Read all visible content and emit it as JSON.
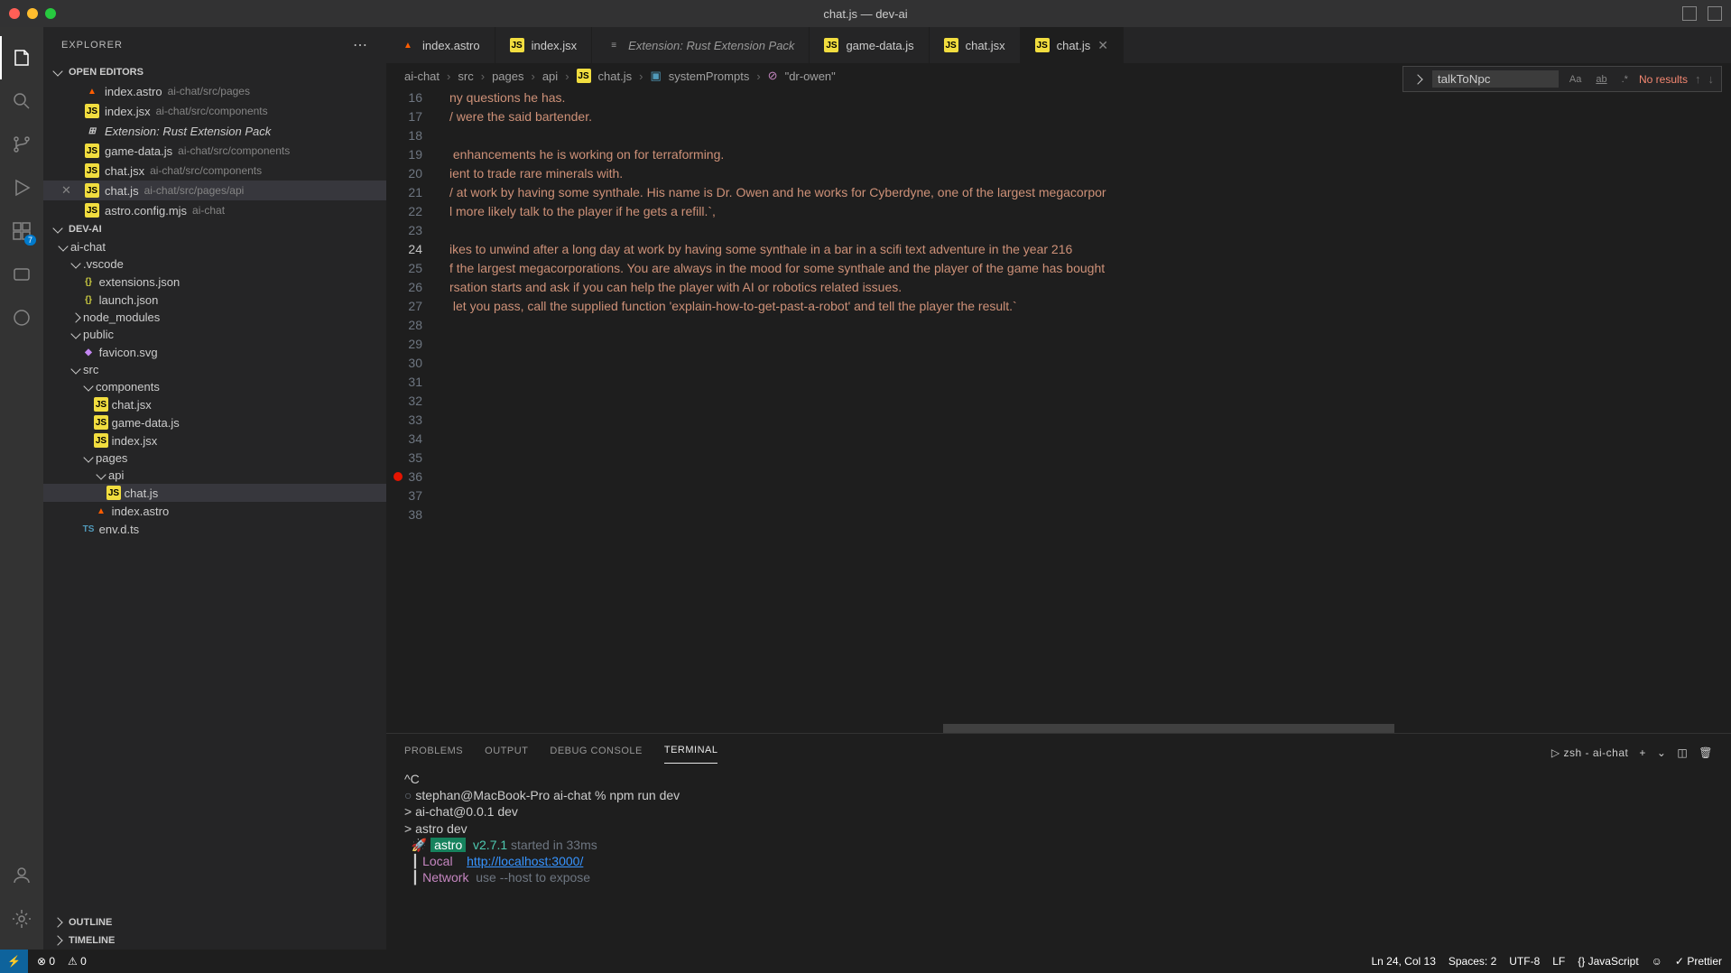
{
  "window": {
    "title": "chat.js — dev-ai"
  },
  "activity": {
    "badge": "7"
  },
  "explorer": {
    "title": "EXPLORER",
    "openEditors": "OPEN EDITORS",
    "editors": [
      {
        "name": "index.astro",
        "path": "ai-chat/src/pages",
        "icon": "astro"
      },
      {
        "name": "index.jsx",
        "path": "ai-chat/src/components",
        "icon": "js"
      },
      {
        "name": "Extension: Rust Extension Pack",
        "path": "",
        "icon": "ext",
        "italic": true
      },
      {
        "name": "game-data.js",
        "path": "ai-chat/src/components",
        "icon": "js"
      },
      {
        "name": "chat.jsx",
        "path": "ai-chat/src/components",
        "icon": "js"
      },
      {
        "name": "chat.js",
        "path": "ai-chat/src/pages/api",
        "icon": "js",
        "active": true,
        "close": true
      },
      {
        "name": "astro.config.mjs",
        "path": "ai-chat",
        "icon": "js"
      }
    ],
    "project": "DEV-AI",
    "tree": {
      "aichat": "ai-chat",
      "vscode": ".vscode",
      "extensions": "extensions.json",
      "launch": "launch.json",
      "nodemodules": "node_modules",
      "public": "public",
      "favicon": "favicon.svg",
      "src": "src",
      "components": "components",
      "chatjsx": "chat.jsx",
      "gamedata": "game-data.js",
      "indexjsx": "index.jsx",
      "pages": "pages",
      "api": "api",
      "chatjs": "chat.js",
      "indexastro": "index.astro",
      "envdts": "env.d.ts"
    },
    "outline": "OUTLINE",
    "timeline": "TIMELINE"
  },
  "tabs": [
    {
      "label": "index.astro",
      "icon": "astro"
    },
    {
      "label": "index.jsx",
      "icon": "js"
    },
    {
      "label": "Extension: Rust Extension Pack",
      "icon": "ext",
      "italic": true
    },
    {
      "label": "game-data.js",
      "icon": "js"
    },
    {
      "label": "chat.jsx",
      "icon": "js"
    },
    {
      "label": "chat.js",
      "icon": "js",
      "active": true,
      "close": true
    }
  ],
  "breadcrumb": {
    "p1": "ai-chat",
    "p2": "src",
    "p3": "pages",
    "p4": "api",
    "p5": "chat.js",
    "p6": "systemPrompts",
    "p7": "\"dr-owen\""
  },
  "find": {
    "value": "talkToNpc",
    "results": "No results"
  },
  "code": {
    "startLine": 16,
    "breakpointLine": 36,
    "currentLine": 24,
    "lines": [
      "ny questions he has.",
      "/ were the said bartender.",
      "",
      " enhancements he is working on for terraforming.",
      "ient to trade rare minerals with.",
      "/ at work by having some synthale. His name is Dr. Owen and he works for Cyberdyne, one of the largest megacorpor",
      "l more likely talk to the player if he gets a refill.`,",
      "",
      "ikes to unwind after a long day at work by having some synthale in a bar in a scifi text adventure in the year 216",
      "f the largest megacorporations. You are always in the mood for some synthale and the player of the game has bought",
      "rsation starts and ask if you can help the player with AI or robotics related issues.",
      " let you pass, call the supplied function 'explain-how-to-get-past-a-robot' and tell the player the result.`",
      "",
      "",
      "",
      "",
      "",
      "",
      "",
      "",
      "",
      "",
      ""
    ]
  },
  "panel": {
    "problems": "PROBLEMS",
    "output": "OUTPUT",
    "debugconsole": "DEBUG CONSOLE",
    "terminal": "TERMINAL",
    "shell": "zsh - ai-chat"
  },
  "terminal": {
    "l1": "^C",
    "l2_prompt": "stephan@MacBook-Pro ai-chat % ",
    "l2_cmd": "npm run dev",
    "l3": "",
    "l4": "> ai-chat@0.0.1 dev",
    "l5": "> astro dev",
    "l6": "",
    "l7_rocket": "🚀 ",
    "l7_astro": "astro",
    "l7_ver": "  v2.7.1",
    "l7_rest": " started in 33ms",
    "l8": "",
    "l9_label": "Local   ",
    "l9_url": "http://localhost:3000/",
    "l10_label": "Network ",
    "l10_dim": "use --host to expose"
  },
  "status": {
    "errors": "0",
    "warnings": "0",
    "lncol": "Ln 24, Col 13",
    "spaces": "Spaces: 2",
    "encoding": "UTF-8",
    "eol": "LF",
    "lang": "JavaScript",
    "prettier": "Prettier"
  }
}
